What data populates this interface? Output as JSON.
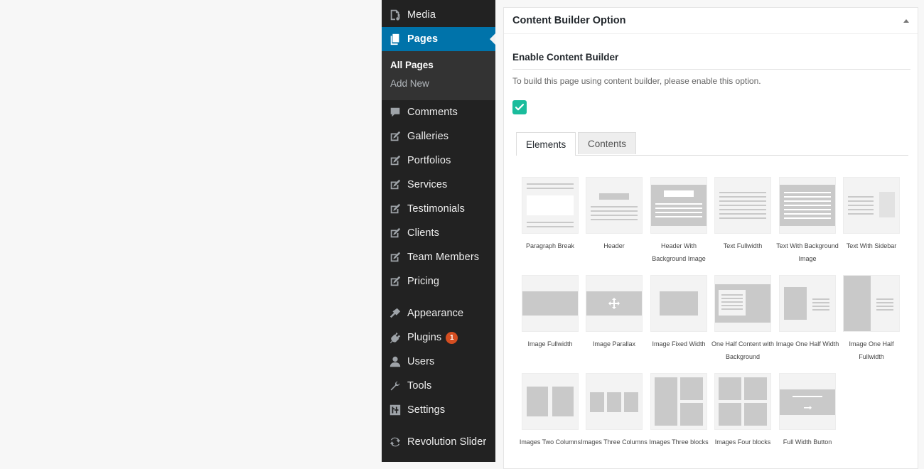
{
  "sidebar": {
    "items": [
      {
        "label": "Media",
        "icon": "media-icon"
      },
      {
        "label": "Pages",
        "icon": "pages-icon"
      },
      {
        "label": "Comments",
        "icon": "comments-icon"
      },
      {
        "label": "Galleries",
        "icon": "edit-icon"
      },
      {
        "label": "Portfolios",
        "icon": "edit-icon"
      },
      {
        "label": "Services",
        "icon": "edit-icon"
      },
      {
        "label": "Testimonials",
        "icon": "edit-icon"
      },
      {
        "label": "Clients",
        "icon": "edit-icon"
      },
      {
        "label": "Team Members",
        "icon": "edit-icon"
      },
      {
        "label": "Pricing",
        "icon": "edit-icon"
      },
      {
        "label": "Appearance",
        "icon": "brush-icon"
      },
      {
        "label": "Plugins",
        "icon": "plug-icon",
        "badge": "1"
      },
      {
        "label": "Users",
        "icon": "user-icon"
      },
      {
        "label": "Tools",
        "icon": "wrench-icon"
      },
      {
        "label": "Settings",
        "icon": "settings-icon"
      },
      {
        "label": "Revolution Slider",
        "icon": "refresh-icon"
      }
    ],
    "submenu": [
      "All Pages",
      "Add New"
    ],
    "colors": {
      "background": "#222222",
      "current": "#0073aa",
      "badge": "#d54e21"
    }
  },
  "panel": {
    "title": "Content Builder Option",
    "option_title": "Enable Content Builder",
    "option_desc": "To build this page using content builder, please enable this option.",
    "checkbox_checked": true,
    "checkbox_color": "#1abc9c",
    "tabs": [
      "Elements",
      "Contents"
    ],
    "active_tab": "Elements",
    "elements": [
      {
        "label": "Paragraph Break"
      },
      {
        "label": "Header"
      },
      {
        "label": "Header With Background Image"
      },
      {
        "label": "Text Fullwidth"
      },
      {
        "label": "Text With Background Image"
      },
      {
        "label": "Text With Sidebar"
      },
      {
        "label": "Image Fullwidth"
      },
      {
        "label": "Image Parallax"
      },
      {
        "label": "Image Fixed Width"
      },
      {
        "label": "One Half Content with Background"
      },
      {
        "label": "Image One Half Width"
      },
      {
        "label": "Image One Half Fullwidth"
      },
      {
        "label": "Images Two Columns"
      },
      {
        "label": "Images Three Columns"
      },
      {
        "label": "Images Three blocks"
      },
      {
        "label": "Images Four blocks"
      },
      {
        "label": "Full Width Button"
      }
    ]
  }
}
